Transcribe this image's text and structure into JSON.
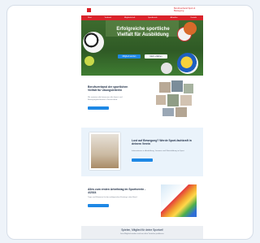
{
  "header": {
    "brand_text": "Berufsverband Sport & Bewegung",
    "nav": [
      "Start",
      "Verband",
      "Mitgliedschaft",
      "Sportberufe",
      "Aktuelles",
      "Kontakt"
    ]
  },
  "hero": {
    "title": "Erfolgreiche sportliche Vielfalt für Ausbildung",
    "primary_button": "Mitglied werden",
    "secondary_button": "Mehr erfahren"
  },
  "sections": [
    {
      "title": "Berufsverband der sportlichen Vielfalt für Übungsleiter/in",
      "text": "Wir vertreten die Interessen aller Sport- und Bewegungsfachkräfte in Deutschland.",
      "button": "Mehr erfahren"
    },
    {
      "title": "Lust auf Bewegung? Werde Sport-fachkraft in deinem Verein",
      "text": "Informationen zu Ausbildung, Lizenzen und Weiterbildung im Sport.",
      "button": "Mehr erfahren"
    },
    {
      "title": "Alles zum ersten Arbeitstag im Sportverein - 4/2024",
      "text": "Tipps und Hinweise für den erfolgreichen Einstieg in den Beruf.",
      "button": "Zum Artikel"
    }
  ],
  "footer": {
    "title": "Spielen, Mitglied für deine Sportart!",
    "text": "Jetzt Mitglied werden und von allen Vorteilen profitieren."
  },
  "colors": {
    "brand": "#d9232a",
    "accent": "#1e88e5",
    "text": "#23324a"
  }
}
